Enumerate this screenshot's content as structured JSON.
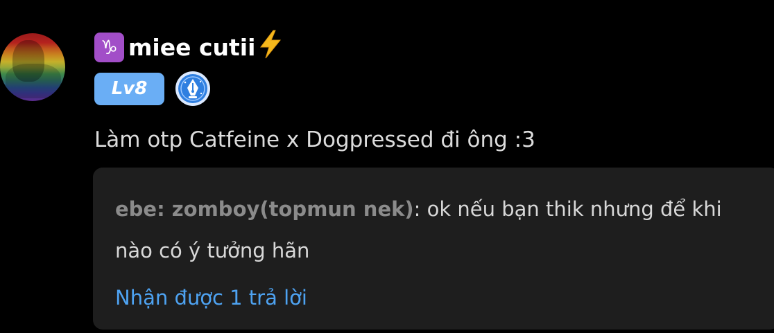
{
  "post": {
    "avatar": "rainbow-flag-avatar",
    "username": "miee cutii",
    "zodiac_icon": "♑",
    "trailing_icon": "⚡",
    "level_badge": "Lv8",
    "writer_badge": "fountain-pen-icon",
    "comment_text": "Làm otp Catfeine x Dogpressed đi ông :3"
  },
  "reply_preview": {
    "author": "ebe: zomboy(topmun nek)",
    "separator": ": ",
    "text": "ok nếu bạn thik nhưng để khi nào có ý tưởng hãn",
    "view_replies_label": "Nhận được 1 trả lời"
  },
  "colors": {
    "background": "#000000",
    "reply_box": "#1e1e1e",
    "level_badge": "#6aaef5",
    "zodiac_badge": "#a24ec8",
    "link": "#4ea3f2",
    "bolt": "#f5b81c"
  }
}
